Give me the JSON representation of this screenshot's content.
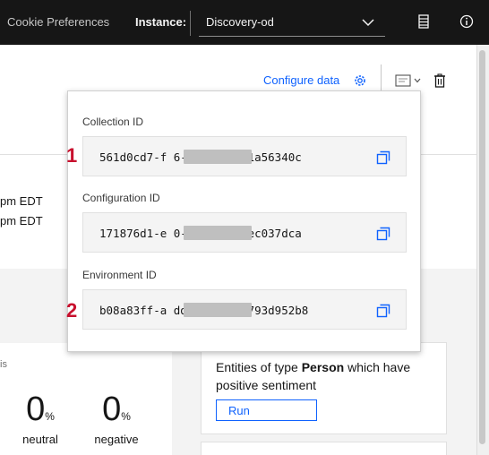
{
  "topbar": {
    "cookie_label": "Cookie Preferences",
    "instance_label": "Instance:",
    "instance_value": "Discovery-od"
  },
  "toolbar": {
    "configure_label": "Configure data"
  },
  "background": {
    "time_1": "pm EDT",
    "time_2": "pm EDT",
    "sentiment_label_fragment": "is",
    "stats": [
      {
        "value": "0",
        "unit": "%",
        "caption": "neutral"
      },
      {
        "value": "0",
        "unit": "%",
        "caption": "negative"
      }
    ],
    "entity_card": {
      "text_pre": "Entities of type ",
      "text_bold": "Person",
      "text_post": " which have positive sentiment",
      "run_label": "Run"
    }
  },
  "popover": {
    "fields": [
      {
        "label": "Collection ID",
        "value": "561d0cd7-f          6-8f2f-49361a56340c"
      },
      {
        "label": "Configuration ID",
        "value": "171876d1-e          0-a1f5-fe2aec037dca"
      },
      {
        "label": "Environment ID",
        "value": "b08a83ff-a          dd-a02c-74f793d952b8"
      }
    ]
  },
  "annotations": {
    "marker_1": "1",
    "marker_2": "2"
  },
  "colors": {
    "accent": "#0f62fe",
    "topbar_bg": "#161616",
    "marker": "#c8102e"
  }
}
